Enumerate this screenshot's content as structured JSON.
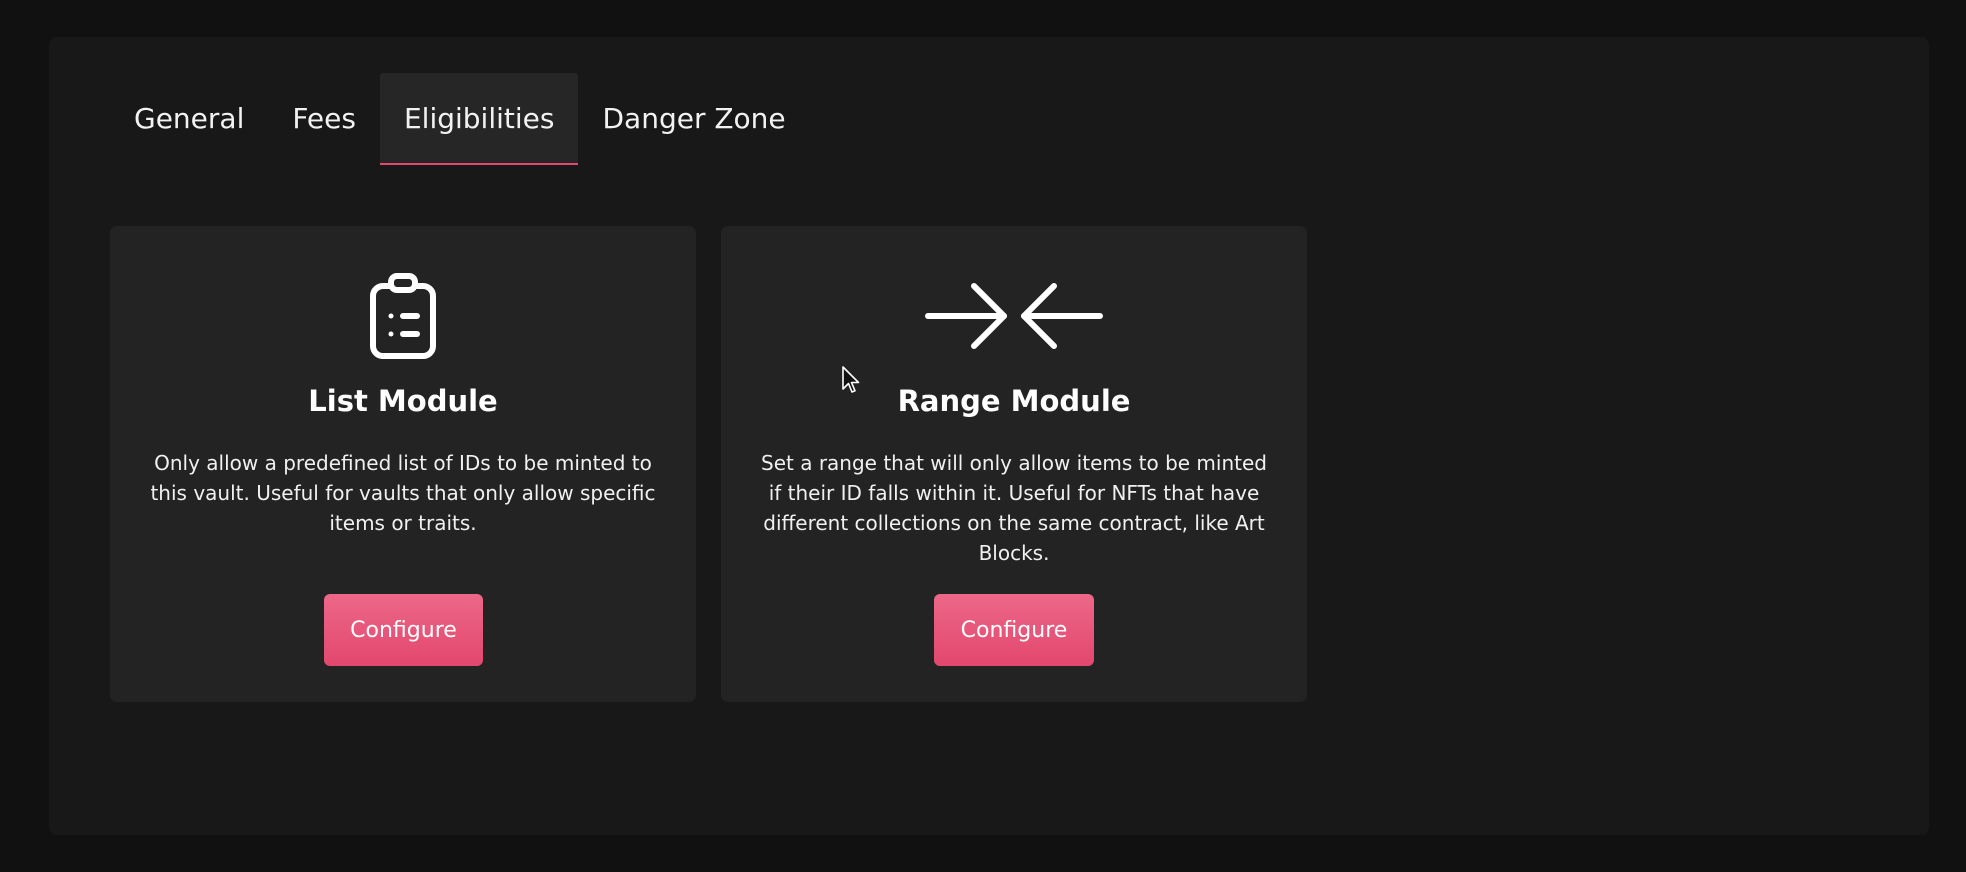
{
  "tabs": [
    {
      "label": "General",
      "active": false
    },
    {
      "label": "Fees",
      "active": false
    },
    {
      "label": "Eligibilities",
      "active": true
    },
    {
      "label": "Danger Zone",
      "active": false
    }
  ],
  "modules": [
    {
      "icon": "clipboard-list-icon",
      "title": "List Module",
      "description": "Only allow a predefined list of IDs to be minted to this vault. Useful for vaults that only allow specific items or traits.",
      "button_label": "Configure"
    },
    {
      "icon": "arrows-converge-icon",
      "title": "Range Module",
      "description": "Set a range that will only allow items to be minted if their ID falls within it. Useful for NFTs that have different collections on the same contract, like Art Blocks.",
      "button_label": "Configure"
    }
  ],
  "colors": {
    "page_bg": "#111111",
    "panel_bg": "#181818",
    "card_bg": "#232323",
    "accent": "#e3476e"
  }
}
